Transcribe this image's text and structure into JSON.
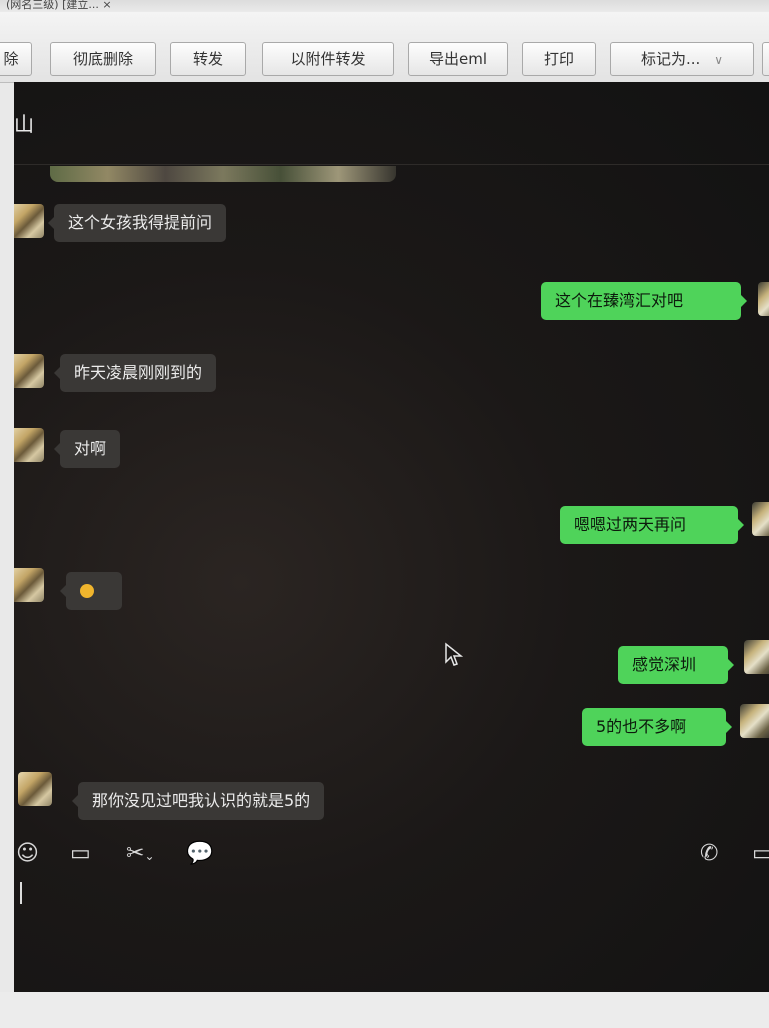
{
  "toolbar": {
    "tab_fragment": "(网名三级)  [建立...   ×",
    "buttons": [
      {
        "label": "除"
      },
      {
        "label": "彻底删除"
      },
      {
        "label": "转发"
      },
      {
        "label": "以附件转发"
      },
      {
        "label": "导出eml"
      },
      {
        "label": "打印"
      },
      {
        "label": "标记为..."
      }
    ]
  },
  "chat": {
    "title": "山",
    "messages": [
      {
        "side": "in",
        "text": "这个女孩我得提前问"
      },
      {
        "side": "out",
        "text": "这个在臻湾汇对吧"
      },
      {
        "side": "in",
        "text": "昨天凌晨刚刚到的"
      },
      {
        "side": "in",
        "text": "对啊"
      },
      {
        "side": "out",
        "text": "嗯嗯过两天再问"
      },
      {
        "side": "in",
        "text": "👌"
      },
      {
        "side": "out",
        "text": "感觉深圳"
      },
      {
        "side": "out",
        "text": "5的也不多啊"
      },
      {
        "side": "in",
        "text": "那你没见过吧我认识的就是5的"
      }
    ]
  },
  "input_toolbar": {
    "icons": [
      "emoji-icon",
      "folder-icon",
      "scissors-icon",
      "chat-bubble-icon",
      "phone-icon",
      "video-icon"
    ]
  },
  "colors": {
    "chat_background": "#1b1817",
    "bubble_incoming": "#3a3836",
    "bubble_outgoing": "#4fd35a"
  }
}
